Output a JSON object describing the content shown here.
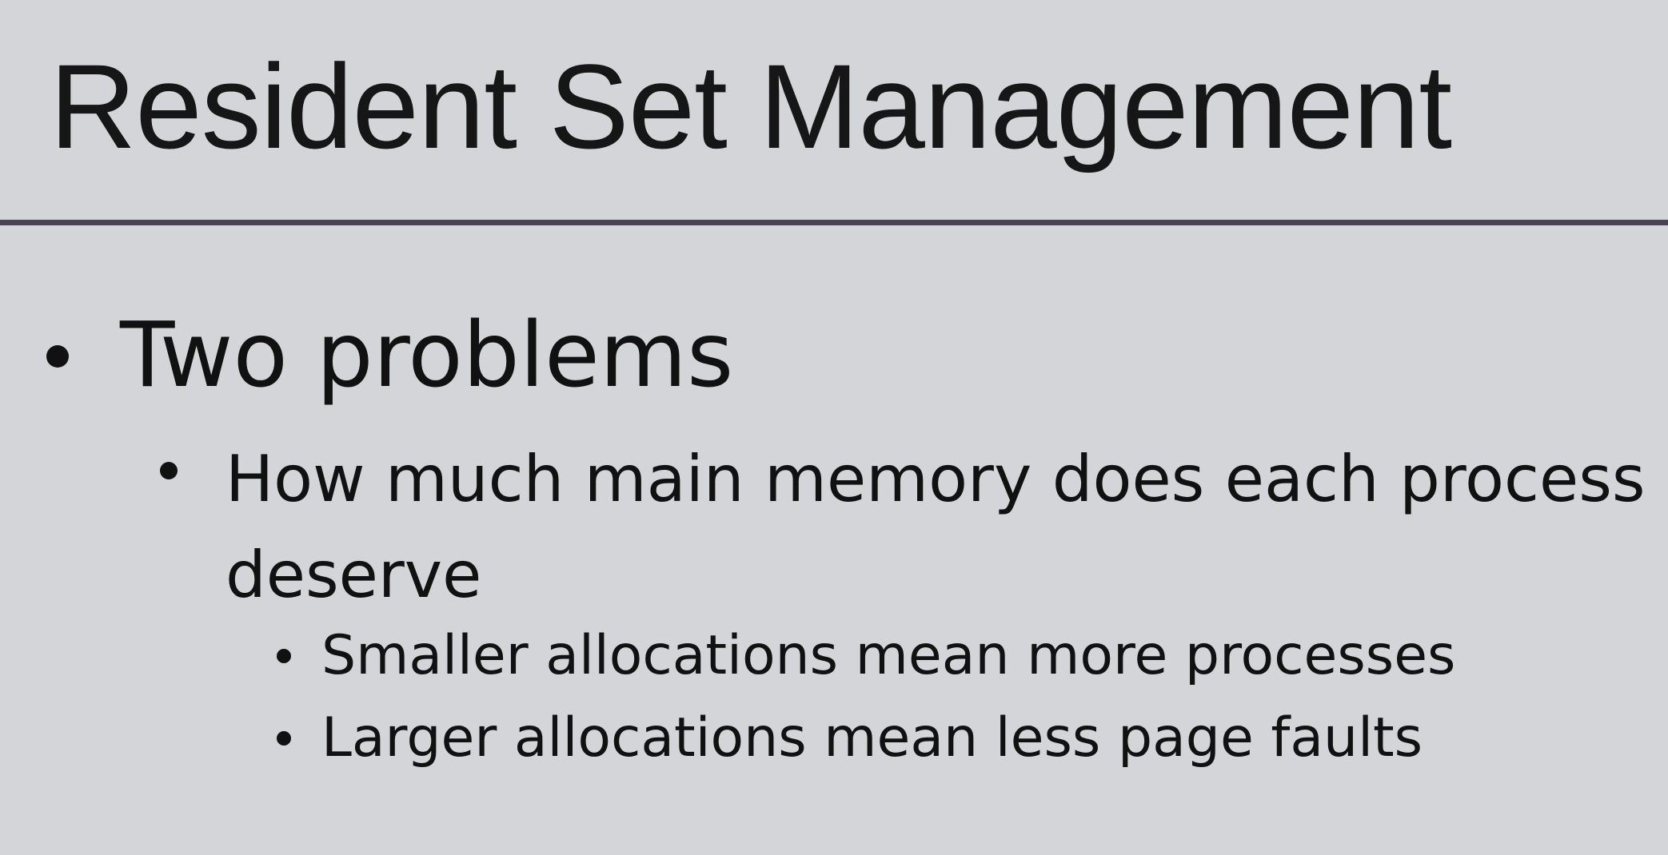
{
  "slide": {
    "title": "Resident Set Management",
    "bullets": [
      {
        "text": "Two problems",
        "children": [
          {
            "text": "How much main memory does each process deserve",
            "children": [
              {
                "text": "Smaller allocations mean more processes"
              },
              {
                "text": "Larger allocations mean less page faults"
              }
            ]
          }
        ]
      }
    ]
  }
}
